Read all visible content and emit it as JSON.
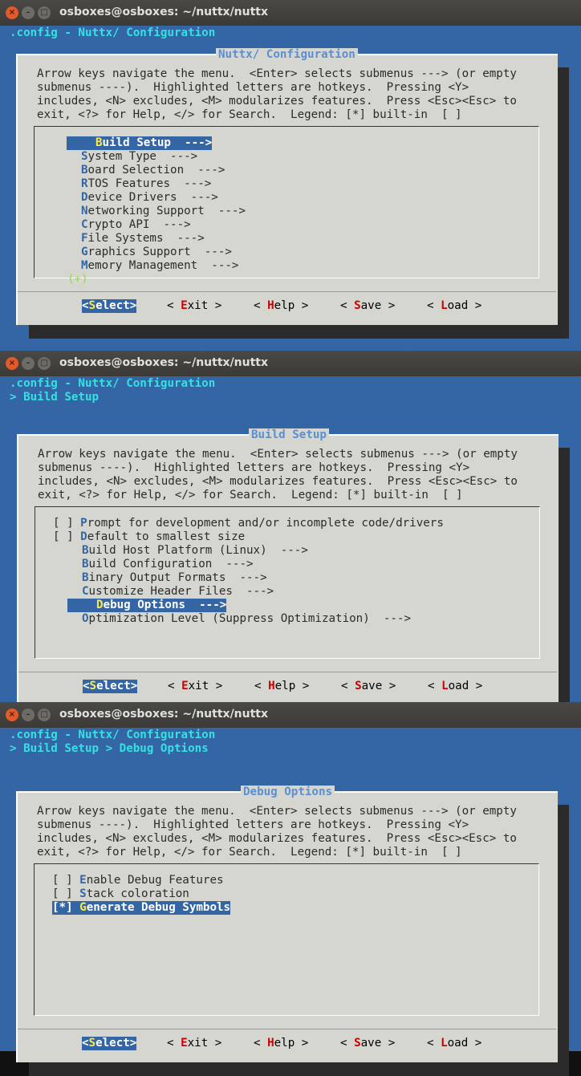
{
  "windows": [
    {
      "title": "osboxes@osboxes: ~/nuttx/nuttx",
      "header_lines": [
        ".config - Nuttx/ Configuration"
      ],
      "dialog_title": "Nuttx/ Configuration",
      "help_lines": [
        "Arrow keys navigate the menu.  <Enter> selects submenus ---> (or empty",
        "submenus ----).  Highlighted letters are hotkeys.  Pressing <Y>",
        "includes, <N> excludes, <M> modularizes features.  Press <Esc><Esc> to",
        "exit, <?> for Help, </> for Search.  Legend: [*] built-in  [ ]"
      ],
      "items": [
        {
          "prefix": "    ",
          "hot": "B",
          "rest": "uild Setup  --->",
          "selected": true
        },
        {
          "prefix": "    ",
          "hot": "S",
          "rest": "ystem Type  --->",
          "selected": false
        },
        {
          "prefix": "    ",
          "hot": "B",
          "rest": "oard Selection  --->",
          "selected": false
        },
        {
          "prefix": "    ",
          "hot": "R",
          "rest": "TOS Features  --->",
          "selected": false
        },
        {
          "prefix": "    ",
          "hot": "D",
          "rest": "evice Drivers  --->",
          "selected": false
        },
        {
          "prefix": "    ",
          "hot": "N",
          "rest": "etworking Support  --->",
          "selected": false
        },
        {
          "prefix": "    ",
          "hot": "C",
          "rest": "rypto API  --->",
          "selected": false
        },
        {
          "prefix": "    ",
          "hot": "F",
          "rest": "ile Systems  --->",
          "selected": false
        },
        {
          "prefix": "    ",
          "hot": "G",
          "rest": "raphics Support  --->",
          "selected": false
        },
        {
          "prefix": "    ",
          "hot": "M",
          "rest": "emory Management  --->",
          "selected": false
        }
      ],
      "more_indicator": "(+)"
    },
    {
      "title": "osboxes@osboxes: ~/nuttx/nuttx",
      "header_lines": [
        ".config - Nuttx/ Configuration",
        "> Build Setup"
      ],
      "dialog_title": "Build Setup",
      "help_lines": [
        "Arrow keys navigate the menu.  <Enter> selects submenus ---> (or empty",
        "submenus ----).  Highlighted letters are hotkeys.  Pressing <Y>",
        "includes, <N> excludes, <M> modularizes features.  Press <Esc><Esc> to",
        "exit, <?> for Help, </> for Search.  Legend: [*] built-in  [ ]"
      ],
      "items": [
        {
          "prefix": "[ ] ",
          "hot": "P",
          "rest": "rompt for development and/or incomplete code/drivers",
          "selected": false
        },
        {
          "prefix": "[ ] ",
          "hot": "D",
          "rest": "efault to smallest size",
          "selected": false
        },
        {
          "prefix": "    ",
          "hot": "B",
          "rest": "uild Host Platform (Linux)  --->",
          "selected": false
        },
        {
          "prefix": "    ",
          "hot": "B",
          "rest": "uild Configuration  --->",
          "selected": false
        },
        {
          "prefix": "    ",
          "hot": "B",
          "rest": "inary Output Formats  --->",
          "selected": false
        },
        {
          "prefix": "    ",
          "hot": "C",
          "rest": "ustomize Header Files  --->",
          "selected": false
        },
        {
          "prefix": "    ",
          "hot": "D",
          "rest": "ebug Options  --->",
          "selected": true
        },
        {
          "prefix": "    ",
          "hot": "O",
          "rest": "ptimization Level (Suppress Optimization)  --->",
          "selected": false
        }
      ],
      "more_indicator": ""
    },
    {
      "title": "osboxes@osboxes: ~/nuttx/nuttx",
      "header_lines": [
        ".config - Nuttx/ Configuration",
        "> Build Setup > Debug Options"
      ],
      "dialog_title": "Debug Options",
      "help_lines": [
        "Arrow keys navigate the menu.  <Enter> selects submenus ---> (or empty",
        "submenus ----).  Highlighted letters are hotkeys.  Pressing <Y>",
        "includes, <N> excludes, <M> modularizes features.  Press <Esc><Esc> to",
        "exit, <?> for Help, </> for Search.  Legend: [*] built-in  [ ]"
      ],
      "items": [
        {
          "prefix": "[ ] ",
          "hot": "E",
          "rest": "nable Debug Features",
          "selected": false
        },
        {
          "prefix": "[ ] ",
          "hot": "S",
          "rest": "tack coloration",
          "selected": false
        },
        {
          "prefix": "[*] ",
          "hot": "G",
          "rest": "enerate Debug Symbols",
          "selected": true
        }
      ],
      "more_indicator": ""
    }
  ],
  "buttons": [
    {
      "pre": "<",
      "hot": "S",
      "rest": "elect>",
      "active": true
    },
    {
      "pre": "< ",
      "hot": "E",
      "rest": "xit >",
      "active": false
    },
    {
      "pre": "< ",
      "hot": "H",
      "rest": "elp >",
      "active": false
    },
    {
      "pre": "< ",
      "hot": "S",
      "rest": "ave >",
      "active": false
    },
    {
      "pre": "< ",
      "hot": "L",
      "rest": "oad >",
      "active": false
    }
  ],
  "window_controls": {
    "close": "×",
    "minimize": "–",
    "maximize": "□"
  }
}
